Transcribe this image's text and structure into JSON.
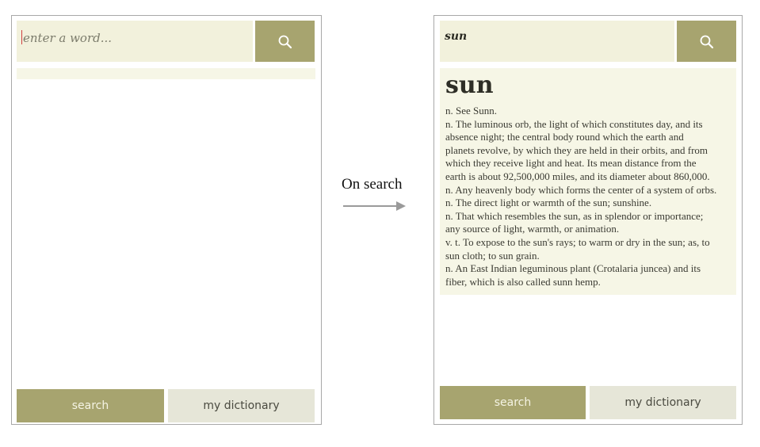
{
  "left_screen": {
    "search_placeholder": "enter a word...",
    "tabs": {
      "search_label": "search",
      "dictionary_label": "my dictionary"
    }
  },
  "transition": {
    "label": "On search"
  },
  "right_screen": {
    "search_value": "sun",
    "headword": "sun",
    "definition_lines": [
      "n.  See Sunn.",
      "n.  The luminous orb, the light of which constitutes day, and its",
      "absence night; the central body round which the earth and",
      "planets revolve, by which they are held in their orbits, and from",
      "which they receive light and heat. Its mean distance from the",
      "earth is about 92,500,000 miles, and its diameter about 860,000.",
      "n.  Any heavenly body which forms the center of a system of orbs.",
      "n.  The direct light or warmth of the sun; sunshine.",
      "n.  That which resembles the sun, as in splendor or importance;",
      "any source of light, warmth, or animation.",
      "v. t.  To expose to the sun's rays; to warm or dry in the sun; as, to",
      "sun cloth; to sun grain.",
      "n.  An East Indian leguminous plant (Crotalaria juncea) and its",
      "fiber, which is also called sunn hemp."
    ],
    "tabs": {
      "search_label": "search",
      "dictionary_label": "my dictionary"
    }
  },
  "colors": {
    "accent": "#a7a46f",
    "field_bg": "#f2f1dc",
    "panel_bg": "#f6f6e6",
    "secondary_tab": "#e6e6d8"
  },
  "icons": {
    "search_button": "search-icon",
    "arrow": "arrow-right-icon"
  }
}
